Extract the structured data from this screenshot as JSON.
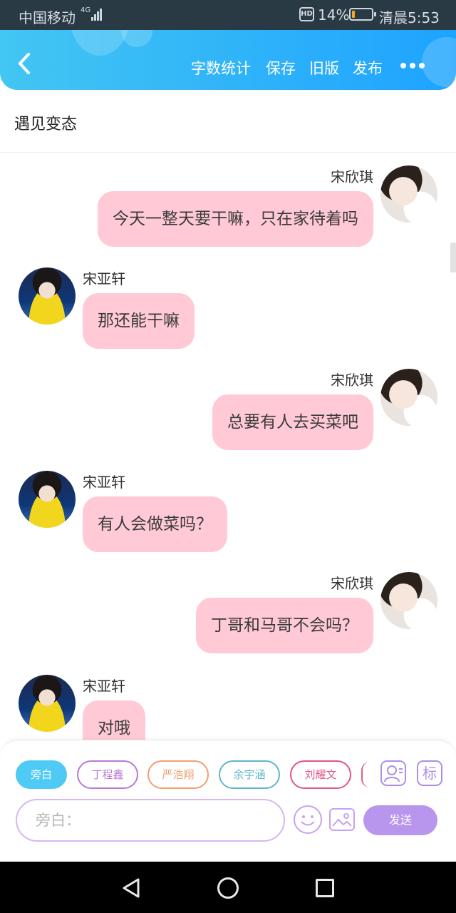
{
  "status_bar": {
    "carrier": "中国移动",
    "network": "4G",
    "hd_badge": "HD",
    "battery_percent": "14%",
    "time": "清晨5:53",
    "battery_level": 0.14
  },
  "toolbar": {
    "actions": [
      "字数统计",
      "保存",
      "旧版",
      "发布"
    ]
  },
  "story_title": "遇见变态",
  "messages": [
    {
      "side": "right",
      "name": "宋欣琪",
      "text": "今天一整天要干嘛，只在家待着吗",
      "avatar": "girl"
    },
    {
      "side": "left",
      "name": "宋亚轩",
      "text": "那还能干嘛",
      "avatar": "boy"
    },
    {
      "side": "right",
      "name": "宋欣琪",
      "text": "总要有人去买菜吧",
      "avatar": "girl"
    },
    {
      "side": "left",
      "name": "宋亚轩",
      "text": "有人会做菜吗？",
      "avatar": "boy"
    },
    {
      "side": "right",
      "name": "宋欣琪",
      "text": "丁哥和马哥不会吗？",
      "avatar": "girl"
    },
    {
      "side": "left",
      "name": "宋亚轩",
      "text": "对哦",
      "avatar": "boy"
    }
  ],
  "role_chips": [
    {
      "label": "旁白",
      "color": "#4fcaf5",
      "active": true
    },
    {
      "label": "丁程鑫",
      "color": "#b67ad6",
      "active": false
    },
    {
      "label": "严浩翔",
      "color": "#f0a070",
      "active": false
    },
    {
      "label": "余宇涵",
      "color": "#5fb6c9",
      "active": false
    },
    {
      "label": "刘耀文",
      "color": "#e0558a",
      "active": false
    }
  ],
  "side_icons": {
    "label_icon_text": "标"
  },
  "input": {
    "placeholder": "旁白："
  },
  "send_label": "发送"
}
